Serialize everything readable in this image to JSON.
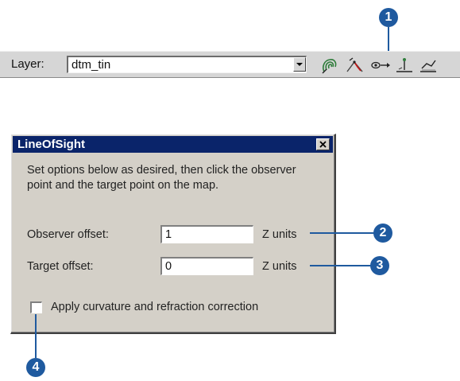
{
  "toolbar": {
    "layer_label": "Layer:",
    "layer_value": "dtm_tin",
    "tools": [
      {
        "icon": "contour-tool-icon"
      },
      {
        "icon": "steepest-path-icon"
      },
      {
        "icon": "line-of-sight-icon"
      },
      {
        "icon": "interpolate-point-icon"
      },
      {
        "icon": "interpolate-line-icon"
      }
    ]
  },
  "dialog": {
    "title": "LineOfSight",
    "instructions": "Set options below as desired, then click the observer point and the target point on the map.",
    "observer_offset": {
      "label": "Observer offset:",
      "value": "1",
      "unit": "Z units"
    },
    "target_offset": {
      "label": "Target offset:",
      "value": "0",
      "unit": "Z units"
    },
    "curvature": {
      "label": "Apply curvature and refraction correction",
      "checked": false
    }
  },
  "callouts": [
    "1",
    "2",
    "3",
    "4"
  ],
  "colors": {
    "callout": "#1f5a9f",
    "titlebar": "#0a246a",
    "dialog_bg": "#d4d0c8"
  }
}
